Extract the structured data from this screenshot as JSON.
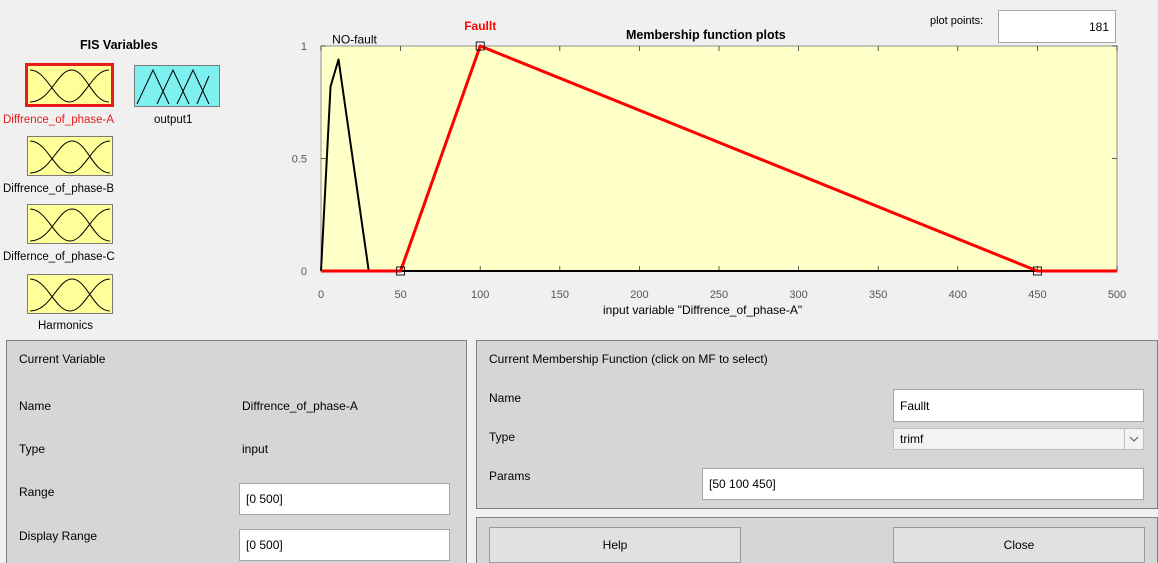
{
  "fis": {
    "title": "FIS Variables",
    "variables": [
      {
        "label": "Diffrence_of_phase-A",
        "kind": "input",
        "selected": true
      },
      {
        "label": "output1",
        "kind": "output",
        "selected": false
      },
      {
        "label": "Diffrence_of_phase-B",
        "kind": "input",
        "selected": false
      },
      {
        "label": "Differnce_of_phase-C",
        "kind": "input",
        "selected": false
      },
      {
        "label": "Harmonics",
        "kind": "input",
        "selected": false
      }
    ]
  },
  "plot": {
    "title": "Membership function plots",
    "points_label": "plot points:",
    "points_value": "181",
    "xlabel": "input variable \"Diffrence_of_phase-A\"",
    "colors": {
      "background": "#ffffc8",
      "selected": "#ff0000",
      "unselected": "#000000"
    }
  },
  "chart_data": {
    "type": "line",
    "xlim": [
      0,
      500
    ],
    "ylim": [
      0,
      1
    ],
    "xticks": [
      0,
      50,
      100,
      150,
      200,
      250,
      300,
      350,
      400,
      450,
      500
    ],
    "yticks": [
      0,
      0.5,
      1
    ],
    "series": [
      {
        "name": "NO-fault",
        "selected": false,
        "x": [
          0,
          6,
          11,
          30,
          500
        ],
        "y": [
          0,
          0.82,
          0.94,
          0,
          0
        ]
      },
      {
        "name": "Faullt",
        "selected": true,
        "x": [
          0,
          50,
          100,
          450,
          500
        ],
        "y": [
          0,
          0,
          1,
          0,
          0
        ]
      }
    ]
  },
  "current_variable": {
    "header": "Current Variable",
    "name_label": "Name",
    "name_value": "Diffrence_of_phase-A",
    "type_label": "Type",
    "type_value": "input",
    "range_label": "Range",
    "range_value": "[0 500]",
    "display_range_label": "Display Range",
    "display_range_value": "[0 500]"
  },
  "current_mf": {
    "header": "Current Membership Function (click on MF to select)",
    "name_label": "Name",
    "name_value": "Faullt",
    "type_label": "Type",
    "type_value": "trimf",
    "params_label": "Params",
    "params_value": "[50 100 450]"
  },
  "buttons": {
    "help": "Help",
    "close": "Close"
  }
}
